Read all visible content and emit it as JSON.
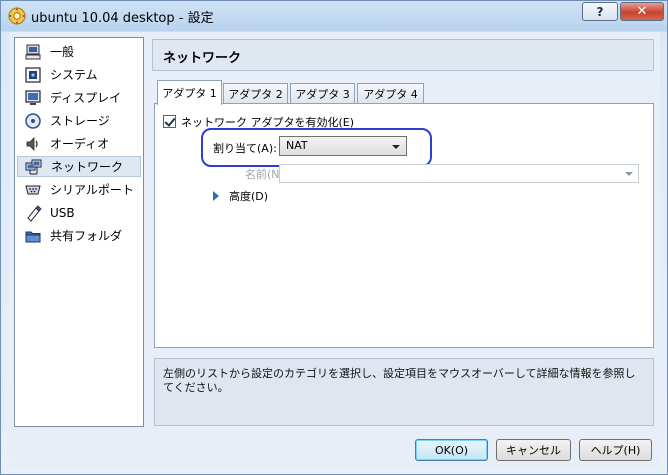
{
  "window": {
    "title": "ubuntu 10.04 desktop - 設定",
    "help_label": "?",
    "close_label": "✕"
  },
  "sidebar": {
    "items": [
      {
        "label": "一般",
        "icon": "general-icon"
      },
      {
        "label": "システム",
        "icon": "system-chip-icon"
      },
      {
        "label": "ディスプレイ",
        "icon": "display-monitor-icon"
      },
      {
        "label": "ストレージ",
        "icon": "storage-disk-icon"
      },
      {
        "label": "オーディオ",
        "icon": "speaker-icon"
      },
      {
        "label": "ネットワーク",
        "icon": "network-icon",
        "selected": true
      },
      {
        "label": "シリアルポート",
        "icon": "serial-port-icon"
      },
      {
        "label": "USB",
        "icon": "usb-pen-icon"
      },
      {
        "label": "共有フォルダ",
        "icon": "shared-folder-icon"
      }
    ]
  },
  "main": {
    "section_title": "ネットワーク",
    "tabs": [
      {
        "label": "アダプタ 1",
        "active": true
      },
      {
        "label": "アダプタ 2",
        "active": false
      },
      {
        "label": "アダプタ 3",
        "active": false
      },
      {
        "label": "アダプタ 4",
        "active": false
      }
    ],
    "enable_adapter_label": "ネットワーク アダプタを有効化(E)",
    "enable_adapter_checked": true,
    "attached_to_label": "割り当て(A):",
    "attached_to_value": "NAT",
    "name_label": "名前(N):",
    "name_value": "",
    "advanced_label": "高度(D)",
    "description": "左側のリストから設定のカテゴリを選択し、設定項目をマウスオーバーして詳細な情報を参照してください。"
  },
  "buttons": {
    "ok": "OK(O)",
    "cancel": "キャンセル",
    "help": "ヘルプ(H)"
  },
  "colors": {
    "highlight_ring": "#2b3fd6",
    "selected_item": "#dde7f2"
  }
}
